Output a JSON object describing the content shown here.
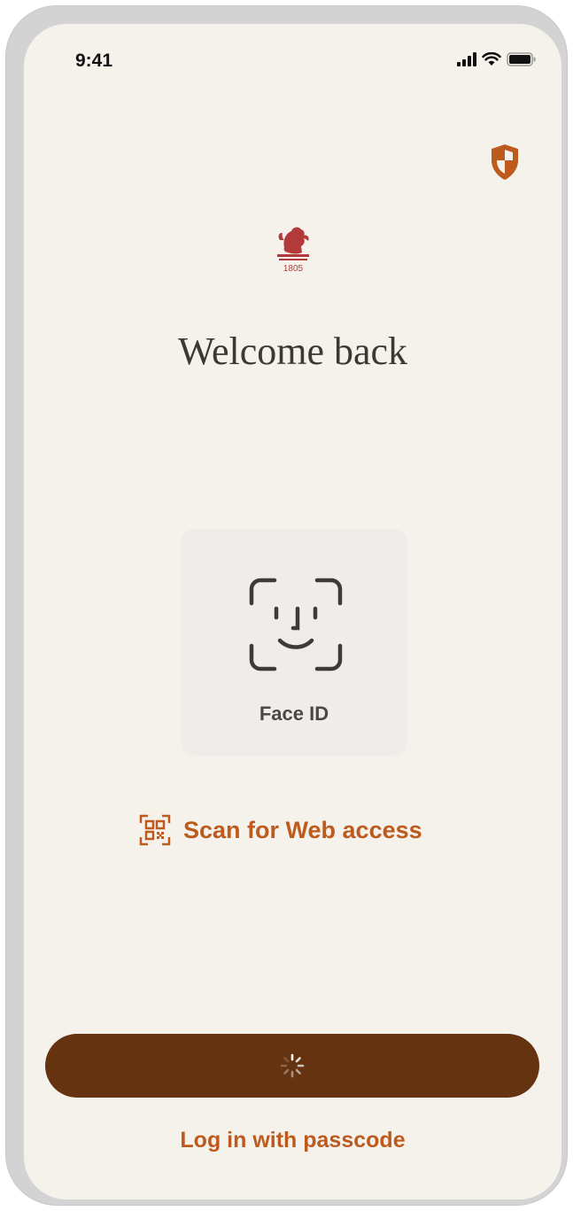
{
  "status_bar": {
    "time": "9:41",
    "icons": [
      "cellular-signal-icon",
      "wifi-icon",
      "battery-icon"
    ]
  },
  "header": {
    "security_icon": "shield-icon"
  },
  "brand": {
    "logo_icon": "lion-crest-logo",
    "logo_year": "1805"
  },
  "main": {
    "title": "Welcome back",
    "face_id": {
      "icon": "face-id-icon",
      "label": "Face ID"
    },
    "scan_link": {
      "icon": "qr-code-icon",
      "label": "Scan for Web access"
    }
  },
  "footer": {
    "primary_button_state": "loading",
    "passcode_link": "Log in with passcode"
  },
  "colors": {
    "background": "#f5f2ec",
    "accent": "#bd5a1e",
    "button": "#663311",
    "title_text": "#3b3836",
    "faceid_box": "#efedea"
  }
}
